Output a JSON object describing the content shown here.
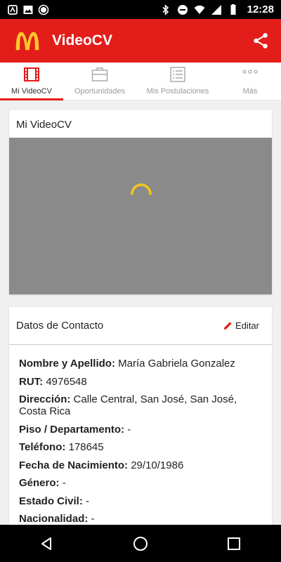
{
  "status_bar": {
    "time": "12:28",
    "left_icons": [
      "notification-icon",
      "image-icon",
      "record-icon"
    ],
    "right_icons": [
      "bluetooth-icon",
      "do-not-disturb-icon",
      "wifi-icon",
      "signal-icon",
      "battery-icon"
    ]
  },
  "app_bar": {
    "title": "VideoCV",
    "brand_color": "#e31d1a",
    "logo_color": "#ffc72c"
  },
  "tabs": [
    {
      "label": "Mi VideoCV",
      "icon": "film-icon",
      "active": true
    },
    {
      "label": "Oportunidades",
      "icon": "briefcase-icon",
      "active": false
    },
    {
      "label": "Mis Postulaciones",
      "icon": "list-icon",
      "active": false
    },
    {
      "label": "Más",
      "icon": "more-icon",
      "active": false
    }
  ],
  "video_card": {
    "title": "Mi VideoCV"
  },
  "contact_card": {
    "title": "Datos de Contacto",
    "edit_label": "Editar",
    "fields": [
      {
        "label": "Nombre y Apellido:",
        "value": "María Gabriela Gonzalez"
      },
      {
        "label": "RUT:",
        "value": "4976548"
      },
      {
        "label": "Dirección:",
        "value": "Calle Central, San José, San José, Costa Rica"
      },
      {
        "label": "Piso / Departamento:",
        "value": "-"
      },
      {
        "label": "Teléfono:",
        "value": "178645"
      },
      {
        "label": "Fecha de Nacimiento:",
        "value": "29/10/1986"
      },
      {
        "label": "Género:",
        "value": "-"
      },
      {
        "label": "Estado Civil:",
        "value": "-"
      },
      {
        "label": "Nacionalidad:",
        "value": "-"
      }
    ]
  }
}
